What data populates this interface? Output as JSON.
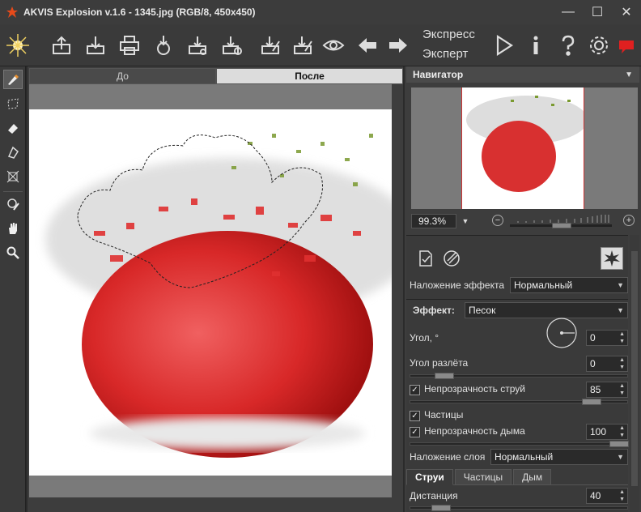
{
  "window": {
    "title": "AKVIS Explosion v.1.6 - 1345.jpg (RGB/8, 450x450)",
    "controls": [
      "minimize-icon",
      "maximize-icon",
      "close-icon"
    ]
  },
  "toolbar": {
    "mode_express": "Экспресс",
    "mode_expert": "Эксперт",
    "icons": [
      "logo-icon",
      "open-icon",
      "save-icon",
      "print-icon",
      "share-icon",
      "batch-icon",
      "batch-settings-icon",
      "load-preset-icon",
      "save-preset-icon",
      "preview-icon",
      "undo-arrow-icon",
      "redo-arrow-icon",
      "run-icon",
      "info-icon",
      "help-icon",
      "settings-icon",
      "feedback-icon"
    ]
  },
  "tools": [
    "brush-icon",
    "lasso-icon",
    "eraser-icon",
    "bucket-icon",
    "transform-icon",
    "sample-brush-icon",
    "hand-icon",
    "zoom-icon"
  ],
  "canvas": {
    "tab_before": "До",
    "tab_after": "После"
  },
  "navigator": {
    "title": "Навигатор",
    "zoom_value": "99.3%",
    "zoom_level": 0.55
  },
  "params": {
    "blend_effect_label": "Наложение эффекта",
    "blend_effect_value": "Нормальный",
    "effect_label": "Эффект:",
    "effect_value": "Песок",
    "angle_label": "Угол, °",
    "angle_value": "0",
    "spread_label": "Угол разлёта",
    "spread_value": "0",
    "stream_opacity_label": "Непрозрачность струй",
    "stream_opacity_value": "85",
    "particles_label": "Частицы",
    "smoke_opacity_label": "Непрозрачность дыма",
    "smoke_opacity_value": "100",
    "layer_blend_label": "Наложение слоя",
    "layer_blend_value": "Нормальный",
    "tabs": [
      "Струи",
      "Частицы",
      "Дым"
    ],
    "distance_label": "Дистанция",
    "distance_value": "40",
    "checkmark": "✓"
  },
  "colors": {
    "accent_red": "#d32020",
    "panel_bg": "#3a3a3a"
  }
}
